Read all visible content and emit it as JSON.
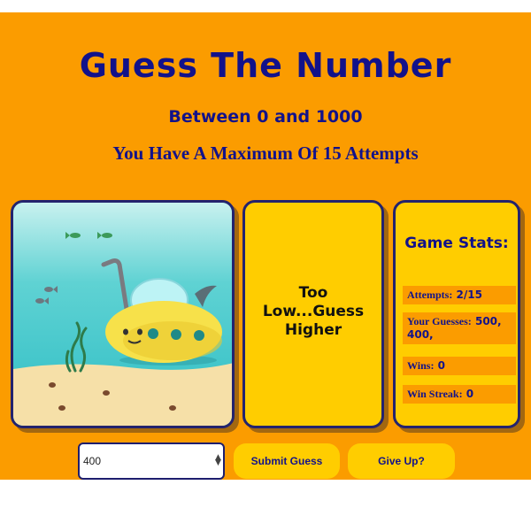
{
  "header": {
    "title": "Guess The Number",
    "range": "Between 0 and 1000",
    "max_attempts": "You Have A Maximum Of 15 Attempts"
  },
  "message": {
    "text": "Too Low...Guess Higher"
  },
  "stats": {
    "title": "Game Stats:",
    "attempts_label": "Attempts:",
    "attempts_value": "2/15",
    "guesses_label": "Your Guesses:",
    "guesses_value": "500, 400,",
    "wins_label": "Wins:",
    "wins_value": "0",
    "streak_label": "Win Streak:",
    "streak_value": "0"
  },
  "controls": {
    "guess_value": "400",
    "submit_label": "Submit Guess",
    "giveup_label": "Give Up?"
  },
  "colors": {
    "background": "#fb9c00",
    "panel": "#ffcd00",
    "text_primary": "#12128a",
    "border": "#23236e"
  },
  "scene": {
    "icons": [
      "submarine-icon",
      "fish-icon",
      "seaweed-icon",
      "shark-fin-icon"
    ]
  }
}
